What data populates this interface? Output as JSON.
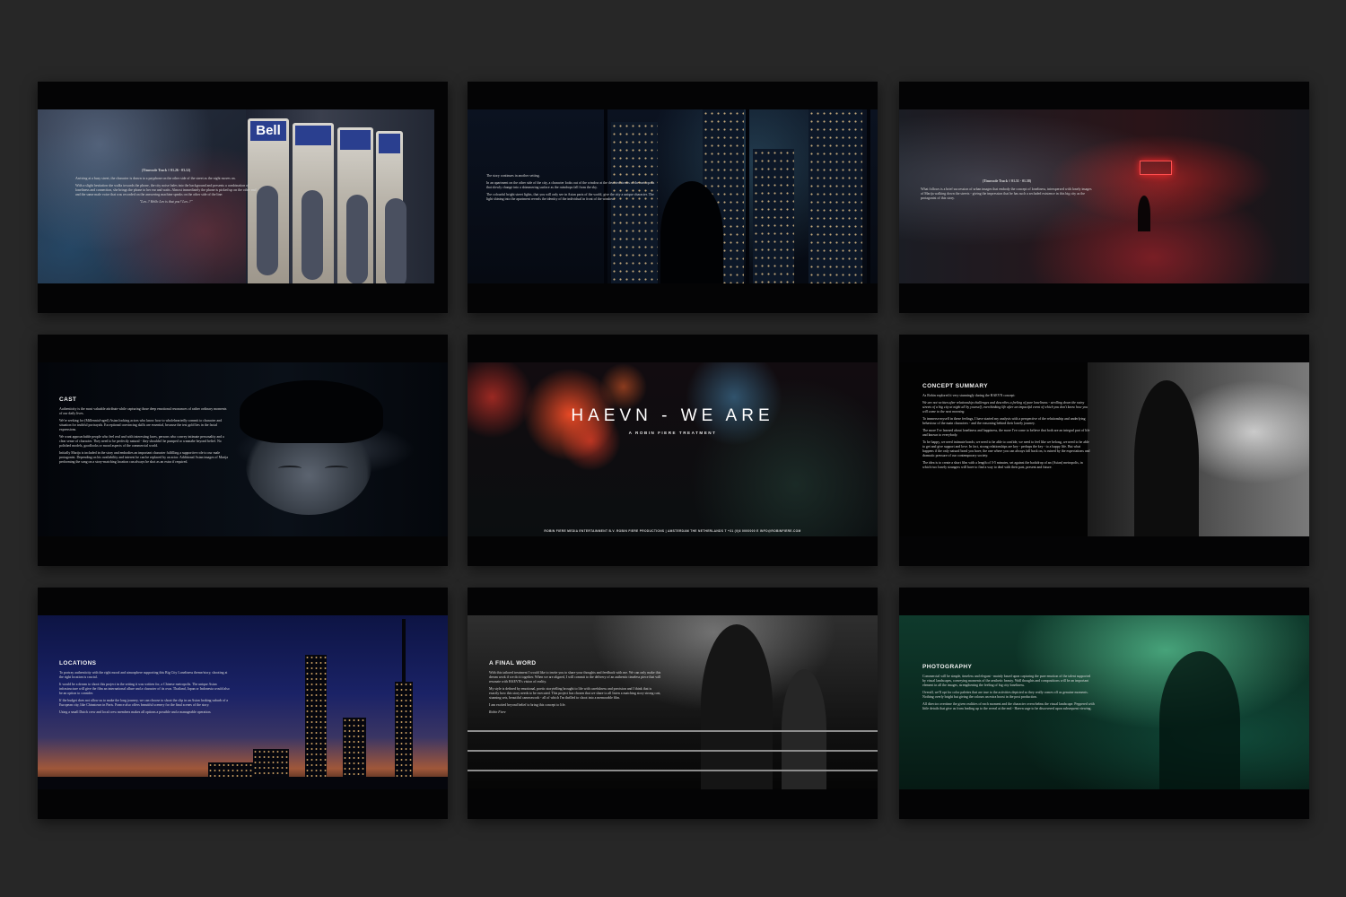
{
  "slides": {
    "s1": {
      "caption": "(Timecode Track // 01.26 - 03.12)",
      "paragraphs": [
        "Arriving at a busy street, the character is drawn to a payphone on the other side of the street as the night moves on.",
        "With a slight hesitation she walks towards the phone, the city noise fades into the background and presents a combination of loneliness and connection, she brings the phone to her ear and waits. Almost immediately the phone is picked up on the other end and the same male voice that was recorded on the answering machine speaks on the other side of the line:"
      ],
      "quote": "\"Lov..? Hello Lov is that you? Lov..?\""
    },
    "s2": {
      "paragraphs": [
        "The story continues in another setting.",
        "In an apartment on the other side of the city, a character looks out of the window at the deserted streets of the metropolis that slowly change into a shimmering surface as the raindrops fall from the sky.",
        "The colourful bright street lights, that you will only see in Asian parts of the world, give the city a unique character. The light shining into the apartment reveals the identity of the individual in front of the window."
      ]
    },
    "s3": {
      "caption": "(Timecode Track // 01.51 - 01.58)",
      "paragraphs": [
        "What follows is a brief succession of urban images that embody the concept of loneliness, interspersed with lonely images of Marija walking down the streets - giving the impression that he has such a secluded existence in this big city as the protagonist of this story."
      ]
    },
    "s4": {
      "heading": "CAST",
      "paragraphs": [
        "Authenticity is the most valuable attribute while capturing those deep emotional resonances of rather ordinary moments of our daily lives.",
        "We're seeking for (Millennial-aged) Asian looking actors who know how to wholeheartedly commit to character and situation for truthful portrayals. Exceptional convincing skills are essential, because the test gold lies in the facial expressions.",
        "We want approachable people who feel real and with interesting faces, persons who convey intimate personality and a clear sense of character. They need to be perfectly natural - they shouldn't be pumped or wannabe beyond belief. No polished models, goodlooks or mood aspects of the commercial world.",
        "Initially Marija is included in the story and embodies an important character fulfilling a supportive role to our male protagonist. Depending on his availability and interest he can be replaced by an actor. Additional Asian images of Marija performing the song on a story-matching location can always be shot as an extra if required."
      ]
    },
    "s5": {
      "title": "HAEVN - WE ARE",
      "subtitle": "A ROBIN FIERE TREATMENT",
      "footer": "ROBIN FIERE MEDIA ENTERTAINMENT B.V. ROBIN FIERE PRODUCTIONS | AMSTERDAM THE NETHERLANDS T +31 (0)6 0000000 E INFO@ROBINFIERE.COM"
    },
    "s6": {
      "heading": "CONCEPT SUMMARY",
      "paragraphs": [
        "As Robin explored it very stunningly during the HAEVN concept:",
        "We are not written after relationship challenges and describes a feeling of pure loneliness - strolling down the rainy streets of a big city at night all by yourself, overthinking life after an impactful event of which you don't know how you will come to the next morning.",
        "To immerse myself in these feelings, I have started my analysis with a perspective of the relationship and underlying behaviour of the main characters - and the reasoning behind their lonely journey.",
        "The more I've learned about loneliness and happiness, the more I've come to believe that both are an integral part of life and known to everybody.",
        "To be happy, we need intimate bonds; we need to be able to confide, we need to feel like we belong, we need to be able to get and give support and love. In fact, strong relationships are key - perhaps the key - to a happy life. But what happens if the only natural bond you have, the one where you can always fall back on, is ruined by the expectations and dramatic pressure of our contemporary society.",
        "The idea is to create a short film with a length of 3-5 minutes, set against the backdrop of an (Asian) metropolis, in which two lonely strangers will have to find a way to deal with their past, present and future."
      ]
    },
    "s7": {
      "heading": "LOCATIONS",
      "paragraphs": [
        "To portray authenticity with the right mood and atmosphere supporting this Big City Loneliness theme/story, shooting at the right location is crucial.",
        "It would be a dream to shoot this project in the setting it was written for, a Chinese metropolis. The unique Asian infrastructure will give the film an international allure and a character of its own. Thailand, Japan or Indonesia would also be an option to consider.",
        "If the budget does not allow us to make the long journey, we can choose to shoot the clip in an Asian looking suburb of a European city, like Chinatown in Paris. France also offers beautiful scenery for the final scenes of the story.",
        "Using a small Dutch crew and local crew members makes all options a possible and a manageable operation."
      ]
    },
    "s8": {
      "heading": "A FINAL WORD",
      "paragraphs": [
        "With this tailored treatment I would like to invite you to share your thoughts and feedback with me. We can only make this dream work if we do it together. When we are aligned, I will commit to the delivery of an authentic timeless piece that will resonate with HAEVN's vision of reality.",
        "My style is defined by emotional, poetic storytelling brought to life with carefulness and precision and I think that is exactly how this story needs to be executed. This project has chosen that we share to all listen a matching story strong cast, stunning sets, beautiful camerawork - all of which I'm thrilled to shoot into a memorable film.",
        "I am excited beyond belief to bring this concept to life."
      ],
      "signature": "Robin Fiere"
    },
    "s9": {
      "heading": "PHOTOGRAPHY",
      "paragraphs": [
        "Commercial will be simple, timeless and elegant - mainly based upon capturing the pure emotion of the talent supported by visual landscapes, conveying moments of the aesthetic beauty. Wall thoughts and compositions will be an important element in all the images, strengthening the feeling of big city loneliness.",
        "Overall, we'll opt for color palettes that are true to the activities depicted so they really comes off as genuine moments. Nothing overly bright but giving the colours an extra boost in the post production.",
        "All director overtime the given realities of each moment and the character overwhelms the visual landscape. Peppered with little details that give us from leading up to the reveal at the end - Haevn urge to be discovered upon subsequent viewing."
      ]
    }
  }
}
